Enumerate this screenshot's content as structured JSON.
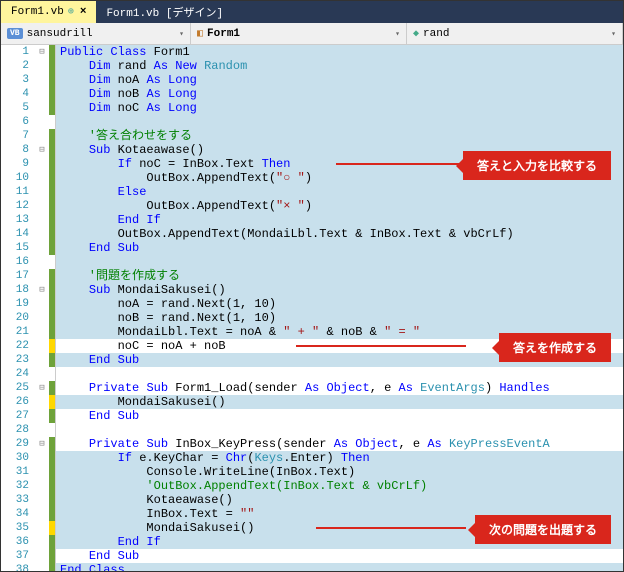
{
  "tabs": [
    {
      "label": "Form1.vb",
      "active": true,
      "pinned": true
    },
    {
      "label": "Form1.vb [デザイン]",
      "active": false
    }
  ],
  "nav": {
    "left": {
      "icon": "VB",
      "text": "sansudrill"
    },
    "mid": {
      "text": "Form1"
    },
    "right": {
      "text": "rand"
    }
  },
  "code": {
    "l1": "Public Class Form1",
    "l2": "    Dim rand As New Random",
    "l3": "    Dim noA As Long",
    "l4": "    Dim noB As Long",
    "l5": "    Dim noC As Long",
    "l6": "",
    "l7": "    '答え合わせをする",
    "l8": "    Sub Kotaeawase()",
    "l9": "        If noC = InBox.Text Then",
    "l10": "            OutBox.AppendText(\"○ \")",
    "l11": "        Else",
    "l12": "            OutBox.AppendText(\"× \")",
    "l13": "        End If",
    "l14": "        OutBox.AppendText(MondaiLbl.Text & InBox.Text & vbCrLf)",
    "l15": "    End Sub",
    "l16": "",
    "l17": "    '問題を作成する",
    "l18": "    Sub MondaiSakusei()",
    "l19": "        noA = rand.Next(1, 10)",
    "l20": "        noB = rand.Next(1, 10)",
    "l21": "        MondaiLbl.Text = noA & \" + \" & noB & \" = \"",
    "l22": "        noC = noA + noB",
    "l23": "    End Sub",
    "l24": "",
    "l25": "    Private Sub Form1_Load(sender As Object, e As EventArgs) Handles",
    "l26": "        MondaiSakusei()",
    "l27": "    End Sub",
    "l28": "",
    "l29": "    Private Sub InBox_KeyPress(sender As Object, e As KeyPressEventA",
    "l30": "        If e.KeyChar = Chr(Keys.Enter) Then",
    "l31": "            Console.WriteLine(InBox.Text)",
    "l32": "            'OutBox.AppendText(InBox.Text & vbCrLf)",
    "l33": "            Kotaeawase()",
    "l34": "            InBox.Text = \"\"",
    "l35": "            MondaiSakusei()",
    "l36": "        End If",
    "l37": "    End Sub",
    "l38": "End Class"
  },
  "callouts": {
    "c1": "答えと入力を比較する",
    "c2": "答えを作成する",
    "c3": "次の問題を出題する"
  },
  "line_meta": [
    {
      "n": 1,
      "fold": "⊟",
      "mark": "green",
      "hl": true
    },
    {
      "n": 2,
      "fold": "",
      "mark": "green",
      "hl": true
    },
    {
      "n": 3,
      "fold": "",
      "mark": "green",
      "hl": true
    },
    {
      "n": 4,
      "fold": "",
      "mark": "green",
      "hl": true
    },
    {
      "n": 5,
      "fold": "",
      "mark": "green",
      "hl": true
    },
    {
      "n": 6,
      "fold": "",
      "mark": "",
      "hl": true
    },
    {
      "n": 7,
      "fold": "",
      "mark": "green",
      "hl": true
    },
    {
      "n": 8,
      "fold": "⊟",
      "mark": "green",
      "hl": true
    },
    {
      "n": 9,
      "fold": "",
      "mark": "green",
      "hl": true
    },
    {
      "n": 10,
      "fold": "",
      "mark": "green",
      "hl": true
    },
    {
      "n": 11,
      "fold": "",
      "mark": "green",
      "hl": true
    },
    {
      "n": 12,
      "fold": "",
      "mark": "green",
      "hl": true
    },
    {
      "n": 13,
      "fold": "",
      "mark": "green",
      "hl": true
    },
    {
      "n": 14,
      "fold": "",
      "mark": "green",
      "hl": true
    },
    {
      "n": 15,
      "fold": "",
      "mark": "green",
      "hl": true
    },
    {
      "n": 16,
      "fold": "",
      "mark": "",
      "hl": true
    },
    {
      "n": 17,
      "fold": "",
      "mark": "green",
      "hl": true
    },
    {
      "n": 18,
      "fold": "⊟",
      "mark": "green",
      "hl": true
    },
    {
      "n": 19,
      "fold": "",
      "mark": "green",
      "hl": true
    },
    {
      "n": 20,
      "fold": "",
      "mark": "green",
      "hl": true
    },
    {
      "n": 21,
      "fold": "",
      "mark": "green",
      "hl": true
    },
    {
      "n": 22,
      "fold": "",
      "mark": "yellow",
      "hl": false
    },
    {
      "n": 23,
      "fold": "",
      "mark": "green",
      "hl": true
    },
    {
      "n": 24,
      "fold": "",
      "mark": "",
      "hl": false
    },
    {
      "n": 25,
      "fold": "⊟",
      "mark": "green",
      "hl": false
    },
    {
      "n": 26,
      "fold": "",
      "mark": "yellow",
      "hl": true
    },
    {
      "n": 27,
      "fold": "",
      "mark": "green",
      "hl": false
    },
    {
      "n": 28,
      "fold": "",
      "mark": "",
      "hl": false
    },
    {
      "n": 29,
      "fold": "⊟",
      "mark": "green",
      "hl": false
    },
    {
      "n": 30,
      "fold": "",
      "mark": "green",
      "hl": true
    },
    {
      "n": 31,
      "fold": "",
      "mark": "green",
      "hl": true
    },
    {
      "n": 32,
      "fold": "",
      "mark": "green",
      "hl": true
    },
    {
      "n": 33,
      "fold": "",
      "mark": "green",
      "hl": true
    },
    {
      "n": 34,
      "fold": "",
      "mark": "green",
      "hl": true
    },
    {
      "n": 35,
      "fold": "",
      "mark": "yellow",
      "hl": true
    },
    {
      "n": 36,
      "fold": "",
      "mark": "green",
      "hl": true
    },
    {
      "n": 37,
      "fold": "",
      "mark": "green",
      "hl": false
    },
    {
      "n": 38,
      "fold": "",
      "mark": "green",
      "hl": true
    }
  ]
}
